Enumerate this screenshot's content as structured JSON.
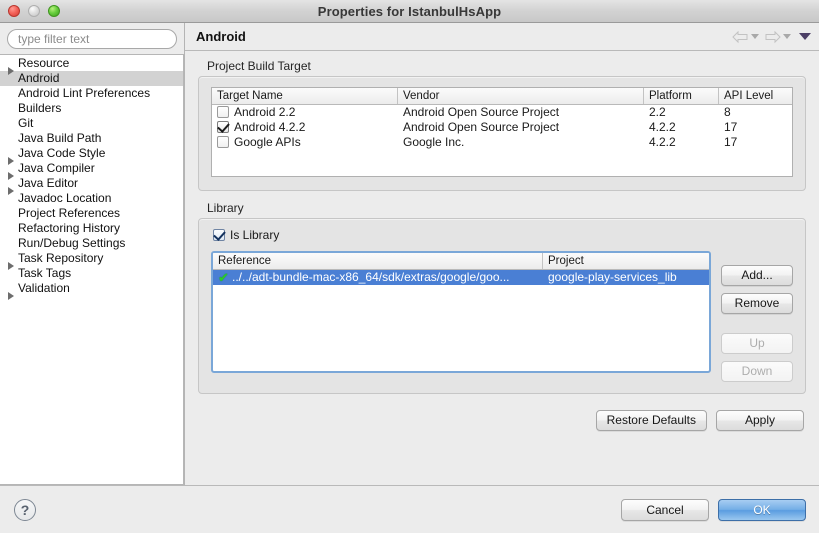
{
  "window": {
    "title": "Properties for IstanbulHsApp",
    "controls": {
      "close": "close",
      "minimize": "minimize",
      "zoom": "zoom"
    }
  },
  "sidebar": {
    "filter_placeholder": "type filter text",
    "filter_value": "",
    "items": [
      {
        "label": "Resource",
        "expandable": true,
        "selected": false
      },
      {
        "label": "Android",
        "expandable": false,
        "selected": true
      },
      {
        "label": "Android Lint Preferences",
        "expandable": false,
        "selected": false
      },
      {
        "label": "Builders",
        "expandable": false,
        "selected": false
      },
      {
        "label": "Git",
        "expandable": false,
        "selected": false
      },
      {
        "label": "Java Build Path",
        "expandable": false,
        "selected": false
      },
      {
        "label": "Java Code Style",
        "expandable": true,
        "selected": false
      },
      {
        "label": "Java Compiler",
        "expandable": true,
        "selected": false
      },
      {
        "label": "Java Editor",
        "expandable": true,
        "selected": false
      },
      {
        "label": "Javadoc Location",
        "expandable": false,
        "selected": false
      },
      {
        "label": "Project References",
        "expandable": false,
        "selected": false
      },
      {
        "label": "Refactoring History",
        "expandable": false,
        "selected": false
      },
      {
        "label": "Run/Debug Settings",
        "expandable": false,
        "selected": false
      },
      {
        "label": "Task Repository",
        "expandable": true,
        "selected": false
      },
      {
        "label": "Task Tags",
        "expandable": false,
        "selected": false
      },
      {
        "label": "Validation",
        "expandable": true,
        "selected": false
      }
    ]
  },
  "page": {
    "title": "Android",
    "nav": {
      "back_label": "Back",
      "forward_label": "Forward",
      "menu_label": "View Menu"
    }
  },
  "build_target": {
    "group_label": "Project Build Target",
    "columns": [
      "Target Name",
      "Vendor",
      "Platform",
      "API Level"
    ],
    "rows": [
      {
        "checked": false,
        "target": "Android 2.2",
        "vendor": "Android Open Source Project",
        "platform": "2.2",
        "api": "8"
      },
      {
        "checked": true,
        "target": "Android 4.2.2",
        "vendor": "Android Open Source Project",
        "platform": "4.2.2",
        "api": "17"
      },
      {
        "checked": false,
        "target": "Google APIs",
        "vendor": "Google Inc.",
        "platform": "4.2.2",
        "api": "17"
      }
    ]
  },
  "library": {
    "group_label": "Library",
    "is_library_label": "Is Library",
    "is_library_checked": true,
    "columns": [
      "Reference",
      "Project"
    ],
    "rows": [
      {
        "status": "ok",
        "reference": "../../adt-bundle-mac-x86_64/sdk/extras/google/goo...",
        "project": "google-play-services_lib",
        "selected": true
      }
    ],
    "buttons": [
      {
        "label": "Add...",
        "enabled": true
      },
      {
        "label": "Remove",
        "enabled": true
      },
      {
        "label": "Up",
        "enabled": false
      },
      {
        "label": "Down",
        "enabled": false
      }
    ]
  },
  "actions": {
    "restore_defaults": "Restore Defaults",
    "apply": "Apply"
  },
  "footer": {
    "help": "?",
    "cancel": "Cancel",
    "ok": "OK"
  },
  "colors": {
    "selection_blue": "#4a7fd4",
    "focus_ring": "#7aa7d8",
    "ok_button": "#5a9ce0",
    "check_green": "#2bcc2b",
    "window_chrome": "#ececec"
  }
}
